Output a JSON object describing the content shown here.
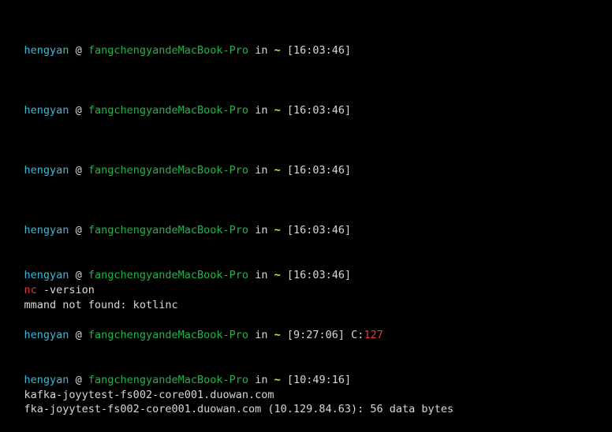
{
  "terminal": {
    "colors": {
      "background": "#000000",
      "user": "#3fb8d4",
      "host": "#22b24c",
      "tilde": "#e8e23a",
      "error": "#e0393e",
      "text": "#d7d7d7"
    },
    "prompts": [
      {
        "user": "hengyan",
        "at": "@",
        "host": "fangchengyandeMacBook-Pro",
        "in": "in",
        "dir": "~",
        "time": "[16:03:46]"
      },
      {
        "user": "hengyan",
        "at": "@",
        "host": "fangchengyandeMacBook-Pro",
        "in": "in",
        "dir": "~",
        "time": "[16:03:46]"
      },
      {
        "user": "hengyan",
        "at": "@",
        "host": "fangchengyandeMacBook-Pro",
        "in": "in",
        "dir": "~",
        "time": "[16:03:46]"
      },
      {
        "user": "hengyan",
        "at": "@",
        "host": "fangchengyandeMacBook-Pro",
        "in": "in",
        "dir": "~",
        "time": "[16:03:46]"
      },
      {
        "user": "hengyan",
        "at": "@",
        "host": "fangchengyandeMacBook-Pro",
        "in": "in",
        "dir": "~",
        "time": "[16:03:46]"
      },
      {
        "user": "hengyan",
        "at": "@",
        "host": "fangchengyandeMacBook-Pro",
        "in": "in",
        "dir": "~",
        "time": "[9:27:06]",
        "code_label": "C:",
        "code_value": "127"
      },
      {
        "user": "hengyan",
        "at": "@",
        "host": "fangchengyandeMacBook-Pro",
        "in": "in",
        "dir": "~",
        "time": "[10:49:16]"
      }
    ],
    "command_1": {
      "name": "nc",
      "args": " -version"
    },
    "error_output": "mmand not found: kotlinc",
    "command_2": "kafka-joyytest-fs002-core001.duowan.com",
    "partial_output": "fka-joyytest-fs002-core001.duowan.com (10.129.84.63): 56 data bytes"
  }
}
